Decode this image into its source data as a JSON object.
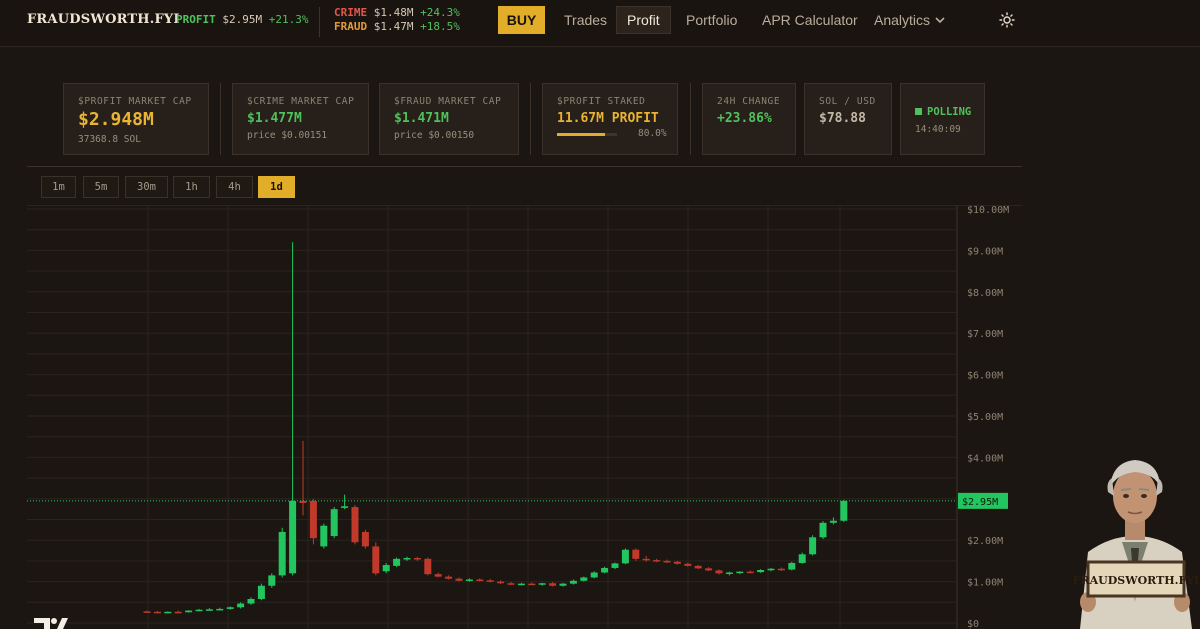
{
  "header": {
    "brand": "FRAUDSWORTH.FYI",
    "profit": {
      "label": "PROFIT",
      "value": "$2.95M",
      "change": "+21.3%"
    },
    "crime": {
      "label": "CRIME",
      "value": "$1.48M",
      "change": "+24.3%"
    },
    "fraud": {
      "label": "FRAUD",
      "value": "$1.47M",
      "change": "+18.5%"
    },
    "buy_label": "BUY",
    "nav": [
      {
        "label": "Trades"
      },
      {
        "label": "Profit"
      },
      {
        "label": "Portfolio"
      },
      {
        "label": "APR Calculator"
      },
      {
        "label": "Analytics"
      }
    ],
    "theme_icon": "sun-icon"
  },
  "stats": {
    "profit_mcap": {
      "label": "$PROFIT MARKET CAP",
      "value": "$2.948M",
      "sub": "37368.8 SOL"
    },
    "crime_mcap": {
      "label": "$CRIME MARKET CAP",
      "value": "$1.477M",
      "sub": "price $0.00151"
    },
    "fraud_mcap": {
      "label": "$FRAUD MARKET CAP",
      "value": "$1.471M",
      "sub": "price $0.00150"
    },
    "staked": {
      "label": "$PROFIT STAKED",
      "value": "11.67M PROFIT",
      "pct_text": "80.0%",
      "pct": 0.8
    },
    "change_24h": {
      "label": "24H CHANGE",
      "value": "+23.86%"
    },
    "sol_usd": {
      "label": "SOL / USD",
      "value": "$78.88"
    },
    "polling": {
      "label": "POLLING",
      "time": "14:40:09"
    }
  },
  "intervals": [
    "1m",
    "5m",
    "30m",
    "1h",
    "4h",
    "1d"
  ],
  "active_interval": "1d",
  "colors": {
    "up": "#22c55e",
    "down": "#c0392b",
    "accent": "#e2ae2a",
    "bg": "#1c1612"
  },
  "chart_data": {
    "type": "candlestick",
    "y_axis_labels": [
      "$10.00M",
      "$9.00M",
      "$8.00M",
      "$7.00M",
      "$6.00M",
      "$5.00M",
      "$4.00M",
      "$3.00M",
      "$2.00M",
      "$1.00M",
      "$0"
    ],
    "ylim": [
      0,
      10
    ],
    "units": "$M",
    "current_price_label": "$2.95M",
    "current_price": 2.95,
    "candles": [
      {
        "o": 0.28,
        "h": 0.3,
        "l": 0.25,
        "c": 0.27
      },
      {
        "o": 0.27,
        "h": 0.29,
        "l": 0.24,
        "c": 0.25
      },
      {
        "o": 0.25,
        "h": 0.28,
        "l": 0.24,
        "c": 0.27
      },
      {
        "o": 0.27,
        "h": 0.3,
        "l": 0.25,
        "c": 0.26
      },
      {
        "o": 0.26,
        "h": 0.31,
        "l": 0.25,
        "c": 0.3
      },
      {
        "o": 0.3,
        "h": 0.34,
        "l": 0.28,
        "c": 0.32
      },
      {
        "o": 0.32,
        "h": 0.36,
        "l": 0.3,
        "c": 0.33
      },
      {
        "o": 0.33,
        "h": 0.37,
        "l": 0.31,
        "c": 0.34
      },
      {
        "o": 0.34,
        "h": 0.4,
        "l": 0.32,
        "c": 0.38
      },
      {
        "o": 0.38,
        "h": 0.5,
        "l": 0.35,
        "c": 0.47
      },
      {
        "o": 0.47,
        "h": 0.62,
        "l": 0.44,
        "c": 0.58
      },
      {
        "o": 0.58,
        "h": 0.95,
        "l": 0.55,
        "c": 0.9
      },
      {
        "o": 0.9,
        "h": 1.2,
        "l": 0.85,
        "c": 1.15
      },
      {
        "o": 1.15,
        "h": 2.3,
        "l": 1.1,
        "c": 2.2
      },
      {
        "o": 1.2,
        "h": 9.2,
        "l": 1.15,
        "c": 2.95
      },
      {
        "o": 2.95,
        "h": 4.4,
        "l": 2.6,
        "c": 2.9
      },
      {
        "o": 2.95,
        "h": 3.0,
        "l": 1.9,
        "c": 2.05
      },
      {
        "o": 1.85,
        "h": 2.4,
        "l": 1.8,
        "c": 2.35
      },
      {
        "o": 2.1,
        "h": 2.8,
        "l": 2.05,
        "c": 2.75
      },
      {
        "o": 2.78,
        "h": 3.1,
        "l": 2.75,
        "c": 2.82
      },
      {
        "o": 2.8,
        "h": 2.85,
        "l": 1.9,
        "c": 1.95
      },
      {
        "o": 2.2,
        "h": 2.25,
        "l": 1.8,
        "c": 1.85
      },
      {
        "o": 1.85,
        "h": 1.95,
        "l": 1.15,
        "c": 1.2
      },
      {
        "o": 1.25,
        "h": 1.45,
        "l": 1.2,
        "c": 1.4
      },
      {
        "o": 1.38,
        "h": 1.58,
        "l": 1.35,
        "c": 1.55
      },
      {
        "o": 1.55,
        "h": 1.6,
        "l": 1.5,
        "c": 1.57
      },
      {
        "o": 1.57,
        "h": 1.6,
        "l": 1.5,
        "c": 1.55
      },
      {
        "o": 1.55,
        "h": 1.58,
        "l": 1.15,
        "c": 1.18
      },
      {
        "o": 1.18,
        "h": 1.22,
        "l": 1.1,
        "c": 1.12
      },
      {
        "o": 1.12,
        "h": 1.15,
        "l": 1.05,
        "c": 1.07
      },
      {
        "o": 1.07,
        "h": 1.1,
        "l": 1.0,
        "c": 1.02
      },
      {
        "o": 1.02,
        "h": 1.08,
        "l": 1.0,
        "c": 1.05
      },
      {
        "o": 1.05,
        "h": 1.08,
        "l": 1.0,
        "c": 1.03
      },
      {
        "o": 1.03,
        "h": 1.06,
        "l": 0.98,
        "c": 1.0
      },
      {
        "o": 1.0,
        "h": 1.03,
        "l": 0.94,
        "c": 0.96
      },
      {
        "o": 0.96,
        "h": 0.99,
        "l": 0.92,
        "c": 0.94
      },
      {
        "o": 0.94,
        "h": 0.97,
        "l": 0.91,
        "c": 0.95
      },
      {
        "o": 0.95,
        "h": 0.98,
        "l": 0.92,
        "c": 0.94
      },
      {
        "o": 0.94,
        "h": 0.97,
        "l": 0.9,
        "c": 0.96
      },
      {
        "o": 0.96,
        "h": 0.99,
        "l": 0.88,
        "c": 0.9
      },
      {
        "o": 0.9,
        "h": 0.97,
        "l": 0.88,
        "c": 0.95
      },
      {
        "o": 0.95,
        "h": 1.05,
        "l": 0.93,
        "c": 1.02
      },
      {
        "o": 1.02,
        "h": 1.12,
        "l": 1.0,
        "c": 1.1
      },
      {
        "o": 1.1,
        "h": 1.25,
        "l": 1.08,
        "c": 1.22
      },
      {
        "o": 1.22,
        "h": 1.36,
        "l": 1.2,
        "c": 1.33
      },
      {
        "o": 1.33,
        "h": 1.46,
        "l": 1.3,
        "c": 1.44
      },
      {
        "o": 1.44,
        "h": 1.8,
        "l": 1.42,
        "c": 1.77
      },
      {
        "o": 1.77,
        "h": 1.8,
        "l": 1.5,
        "c": 1.55
      },
      {
        "o": 1.55,
        "h": 1.62,
        "l": 1.48,
        "c": 1.52
      },
      {
        "o": 1.52,
        "h": 1.55,
        "l": 1.47,
        "c": 1.5
      },
      {
        "o": 1.5,
        "h": 1.53,
        "l": 1.45,
        "c": 1.48
      },
      {
        "o": 1.48,
        "h": 1.5,
        "l": 1.41,
        "c": 1.43
      },
      {
        "o": 1.43,
        "h": 1.46,
        "l": 1.36,
        "c": 1.38
      },
      {
        "o": 1.38,
        "h": 1.4,
        "l": 1.3,
        "c": 1.32
      },
      {
        "o": 1.32,
        "h": 1.35,
        "l": 1.25,
        "c": 1.27
      },
      {
        "o": 1.27,
        "h": 1.29,
        "l": 1.17,
        "c": 1.2
      },
      {
        "o": 1.2,
        "h": 1.24,
        "l": 1.15,
        "c": 1.22
      },
      {
        "o": 1.22,
        "h": 1.25,
        "l": 1.18,
        "c": 1.24
      },
      {
        "o": 1.24,
        "h": 1.27,
        "l": 1.2,
        "c": 1.23
      },
      {
        "o": 1.23,
        "h": 1.3,
        "l": 1.21,
        "c": 1.28
      },
      {
        "o": 1.28,
        "h": 1.33,
        "l": 1.25,
        "c": 1.31
      },
      {
        "o": 1.31,
        "h": 1.34,
        "l": 1.26,
        "c": 1.29
      },
      {
        "o": 1.29,
        "h": 1.48,
        "l": 1.27,
        "c": 1.45
      },
      {
        "o": 1.45,
        "h": 1.7,
        "l": 1.43,
        "c": 1.66
      },
      {
        "o": 1.66,
        "h": 2.12,
        "l": 1.63,
        "c": 2.07
      },
      {
        "o": 2.07,
        "h": 2.46,
        "l": 2.03,
        "c": 2.42
      },
      {
        "o": 2.42,
        "h": 2.55,
        "l": 2.38,
        "c": 2.47
      },
      {
        "o": 2.47,
        "h": 2.98,
        "l": 2.44,
        "c": 2.95
      }
    ]
  },
  "mascot": {
    "sign_text": "FRAUDSWORTH.FYI"
  }
}
